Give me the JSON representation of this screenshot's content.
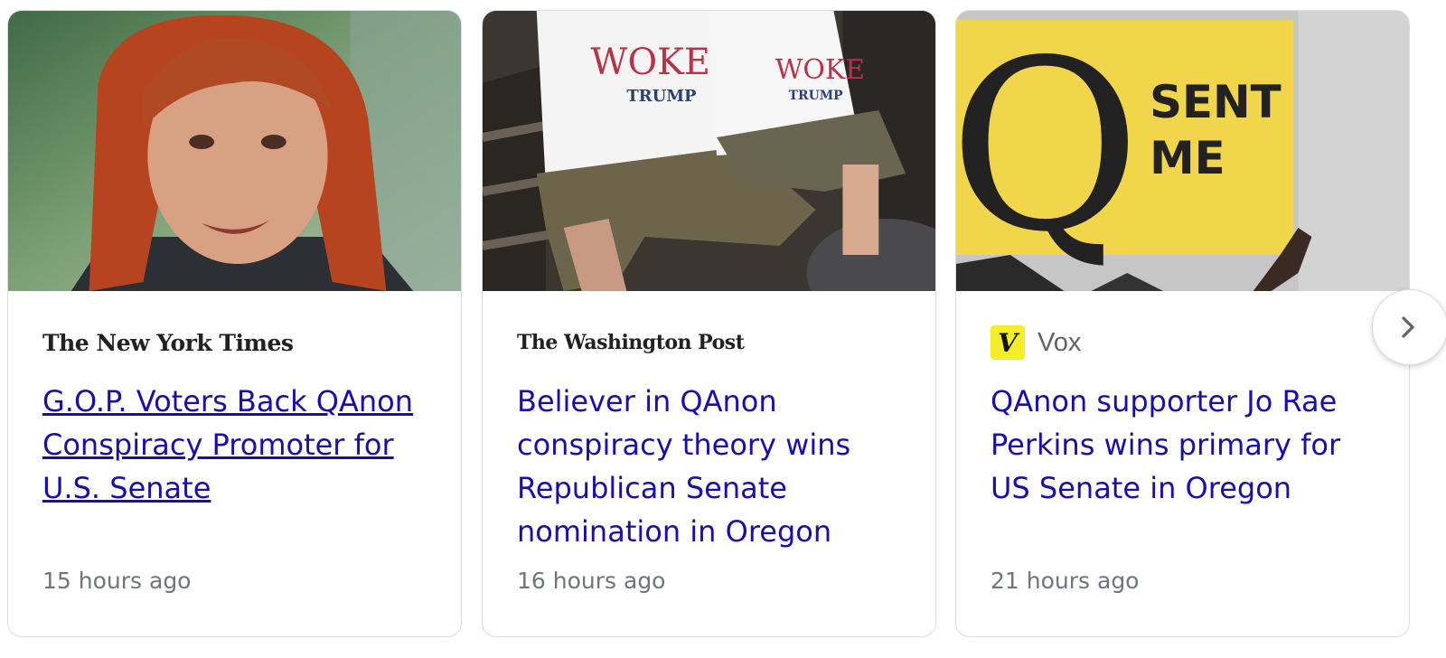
{
  "articles": [
    {
      "source": "The New York Times",
      "headline": "G.O.P. Voters Back QAnon Conspiracy Promoter for U.S. Senate",
      "time": "15 hours ago"
    },
    {
      "source": "The Washington Post",
      "headline": "Believer in QAnon conspiracy theory wins Republican Senate nomination in Oregon",
      "time": "16 hours ago"
    },
    {
      "source": "Vox",
      "source_badge": "V",
      "headline": "QAnon supporter Jo Rae Perkins wins primary for US Senate in Oregon",
      "time": "21 hours ago"
    }
  ],
  "image_text": {
    "shirt_top": "WOKE",
    "shirt_bottom": "TRUMP",
    "sign_letter": "Q",
    "sign_line1": "SENT",
    "sign_line2": "ME"
  },
  "next_icon": "chevron-right-icon",
  "colors": {
    "link": "#1a0dab",
    "meta": "#70757a",
    "vox_yellow": "#f4ee2a"
  }
}
